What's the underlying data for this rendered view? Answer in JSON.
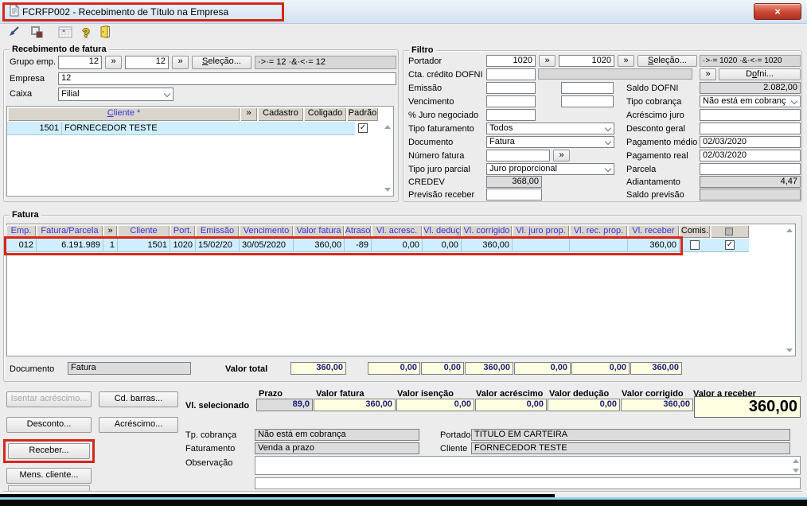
{
  "window": {
    "title": "FCRFP002 - Recebimento de Título na Empresa"
  },
  "glyphs": {
    "close": "×",
    "double_chevron": "»",
    "check": "✓"
  },
  "recebimento": {
    "legend": "Recebimento de fatura",
    "grupo_emp_label": "Grupo emp.",
    "grupo_emp_from": "12",
    "grupo_emp_to": "12",
    "selecao_accel": "S",
    "selecao_rest": "eleção...",
    "grupo_range": "·>·= 12 ·&·<·= 12",
    "empresa_label": "Empresa",
    "empresa_value": "12",
    "caixa_label": "Caixa",
    "caixa_value": "Filial",
    "cliente_accel": "C",
    "cliente_rest": "liente *",
    "cadastro": "Cadastro",
    "coligado": "Coligado",
    "padrao": "Padrão",
    "cliente_row": {
      "codigo": "1501",
      "nome": "FORNECEDOR TESTE"
    }
  },
  "filtro": {
    "legend": "Filtro",
    "portador_label": "Portador",
    "portador_from": "1020",
    "portador_to": "1020",
    "selecao_accel": "S",
    "selecao_rest": "eleção...",
    "portador_range": "·>·= 1020 ·&·<·= 1020",
    "cta_credito_label": "Cta. crédito DOFNI",
    "dofni_pre": "D",
    "dofni_accel": "o",
    "dofni_rest": "fni...",
    "emissao_label": "Emissão",
    "vencimento_label": "Vencimento",
    "juro_negociado_label": "% Juro negociado",
    "tipo_faturamento_label": "Tipo faturamento",
    "tipo_faturamento_value": "Todos",
    "documento_label": "Documento",
    "documento_value": "Fatura",
    "numero_fatura_label": "Número fatura",
    "tipo_juro_label": "Tipo juro parcial",
    "tipo_juro_value": "Juro proporcional",
    "credev_label": "CREDEV",
    "credev_value": "368,00",
    "previsao_label": "Previsão receber",
    "saldo_dofni_label": "Saldo DOFNI",
    "saldo_dofni_value": "2.082,00",
    "tipo_cobranca_label": "Tipo cobrança",
    "tipo_cobranca_value": "Não está em cobranç",
    "acrescimo_juro_label": "Acréscimo juro",
    "desconto_geral_label": "Desconto geral",
    "pagamento_medio_label": "Pagamento médio",
    "pagamento_medio_value": "02/03/2020",
    "pagamento_real_label": "Pagamento real",
    "pagamento_real_value": "02/03/2020",
    "parcela_label": "Parcela",
    "adiantamento_label": "Adiantamento",
    "adiantamento_value": "4,47",
    "saldo_previsao_label": "Saldo previsão"
  },
  "fatura": {
    "legend": "Fatura",
    "columns": [
      "Emp.",
      "Fatura/Parcela",
      "»",
      "Cliente",
      "Port.",
      "Emissão",
      "Vencimento",
      "Valor fatura",
      "Atraso",
      "Vl. acresc.",
      "Vl. deduç",
      "Vl. corrigido",
      "Vl. juro prop.",
      "Vl. rec. prop.",
      "Vl. receber",
      "Comis."
    ],
    "row": [
      "012",
      "6.191.989",
      "1",
      "1501",
      "1020",
      "15/02/20",
      "30/05/2020",
      "360,00",
      "-89",
      "0,00",
      "0,00",
      "360,00",
      "",
      "",
      "360,00"
    ],
    "documento_label": "Documento",
    "documento_value": "Fatura",
    "valor_total_label": "Valor total",
    "totals": [
      "360,00",
      "0,00",
      "0,00",
      "360,00",
      "0,00",
      "0,00",
      "360,00"
    ]
  },
  "rodape": {
    "btn_isentar": "Isentar acréscimo...",
    "btn_cd_barras": "Cd. barras...",
    "btn_desconto": "Desconto...",
    "btn_acrescimo": "Acréscimo...",
    "btn_receber": "Receber...",
    "btn_mens_cliente": "Mens. cliente...",
    "vl_selecionado_label": "Vl. selecionado",
    "sum_headers": [
      "Prazo",
      "Valor fatura",
      "Valor isenção",
      "Valor acréscimo",
      "Valor dedução",
      "Valor corrigido",
      "Valor a receber"
    ],
    "sum_values": [
      "89,0",
      "360,00",
      "0,00",
      "0,00",
      "0,00",
      "360,00",
      "360,00"
    ],
    "tp_cobranca_label": "Tp. cobrança",
    "tp_cobranca_value": "Não está em cobrança",
    "faturamento_label": "Faturamento",
    "faturamento_value": "Venda a prazo",
    "observacao_label": "Observação",
    "portador_label": "Portador",
    "portador_value": "TITULO EM CARTEIRA",
    "cliente_label": "Cliente",
    "cliente_value": "FORNECEDOR TESTE"
  }
}
